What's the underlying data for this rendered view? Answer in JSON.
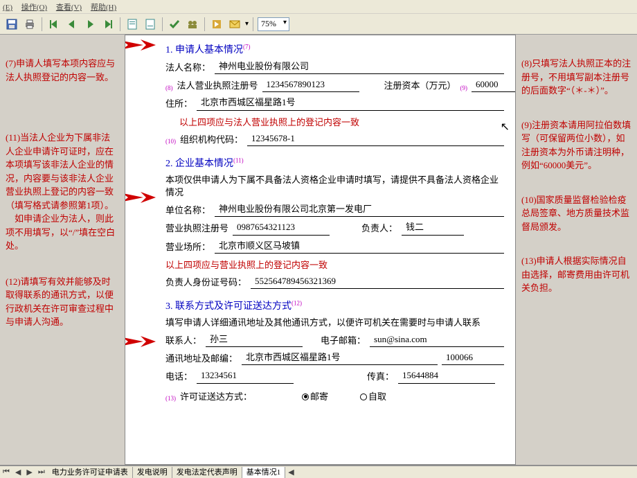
{
  "menu": {
    "file": "(E)",
    "op": "操作(O)",
    "view": "查看(V)",
    "help": "帮助(H)"
  },
  "zoom": "75%",
  "left_notes": {
    "n7": "(7)申请人填写本项内容应与法人执照登记的内容一致。",
    "n11": "(11)当法人企业为下属非法人企业申请许可证时，应在本项填写该非法人企业的情况，内容要与该非法人企业营业执照上登记的内容一致（填写格式请参照第1项）。\n　如申请企业为法人，则此项不用填写，以“/”填在空白处。",
    "n12": "(12)请填写有效并能够及时取得联系的通讯方式，以便行政机关在许可审查过程中与申请人沟通。"
  },
  "right_notes": {
    "n8": "(8)只填写法人执照正本的注册号，不用填写副本注册号的后面数字“（＊-＊）”。",
    "n9": "(9)注册资本请用阿拉伯数填写（可保留两位小数），如注册资本为外币请注明种，例如“60000美元”。",
    "n10": "(10)国家质量监督检验检疫总局签章、地方质量技术监督局颁发。",
    "n13": "(13)申请人根据实际情况自由选择，邮寄费用由许可机关负担。"
  },
  "sec1": {
    "title": "1. 申请人基本情况",
    "l_name": "法人名称：",
    "v_name": "神州电业股份有限公司",
    "l_license": "法人营业执照注册号",
    "v_license": "1234567890123",
    "l_capital": "注册资本（万元）",
    "v_capital": "60000",
    "l_addr": "住所：",
    "v_addr": "北京市西城区福星路1号",
    "hint": "以上四项应与法人营业执照上的登记内容一致",
    "l_org": "组织机构代码：",
    "v_org": "12345678-1"
  },
  "sec2": {
    "title": "2. 企业基本情况",
    "desc": "本项仅供申请人为下属不具备法人资格企业申请时填写，请提供不具备法人资格企业情况",
    "l_unit": "单位名称：",
    "v_unit": "神州电业股份有限公司北京第一发电厂",
    "l_license": "营业执照注册号",
    "v_license": "0987654321123",
    "l_owner": "负责人：",
    "v_owner": "钱二",
    "l_place": "营业场所：",
    "v_place": "北京市顺义区马坡镇",
    "hint": "以上四项应与营业执照上的登记内容一致",
    "l_id": "负责人身份证号码：",
    "v_id": "552564789456321369"
  },
  "sec3": {
    "title": "3. 联系方式及许可证送达方式",
    "desc": "填写申请人详细通讯地址及其他通讯方式，以便许可机关在需要时与申请人联系",
    "l_contact": "联系人：",
    "v_contact": "孙三",
    "l_email": "电子邮箱：",
    "v_email": "sun@sina.com",
    "l_addr": "通讯地址及邮编：",
    "v_addr": "北京市西城区福星路1号",
    "v_zip": "100066",
    "l_tel": "电话：",
    "v_tel": "13234561",
    "l_fax": "传真：",
    "v_fax": "15644884",
    "l_delivery": "许可证送达方式：",
    "r1": "邮寄",
    "r2": "自取"
  },
  "tabs": {
    "t1": "电力业务许可证申请表",
    "t2": "发电说明",
    "t3": "发电法定代表声明",
    "t4": "基本情况1"
  }
}
